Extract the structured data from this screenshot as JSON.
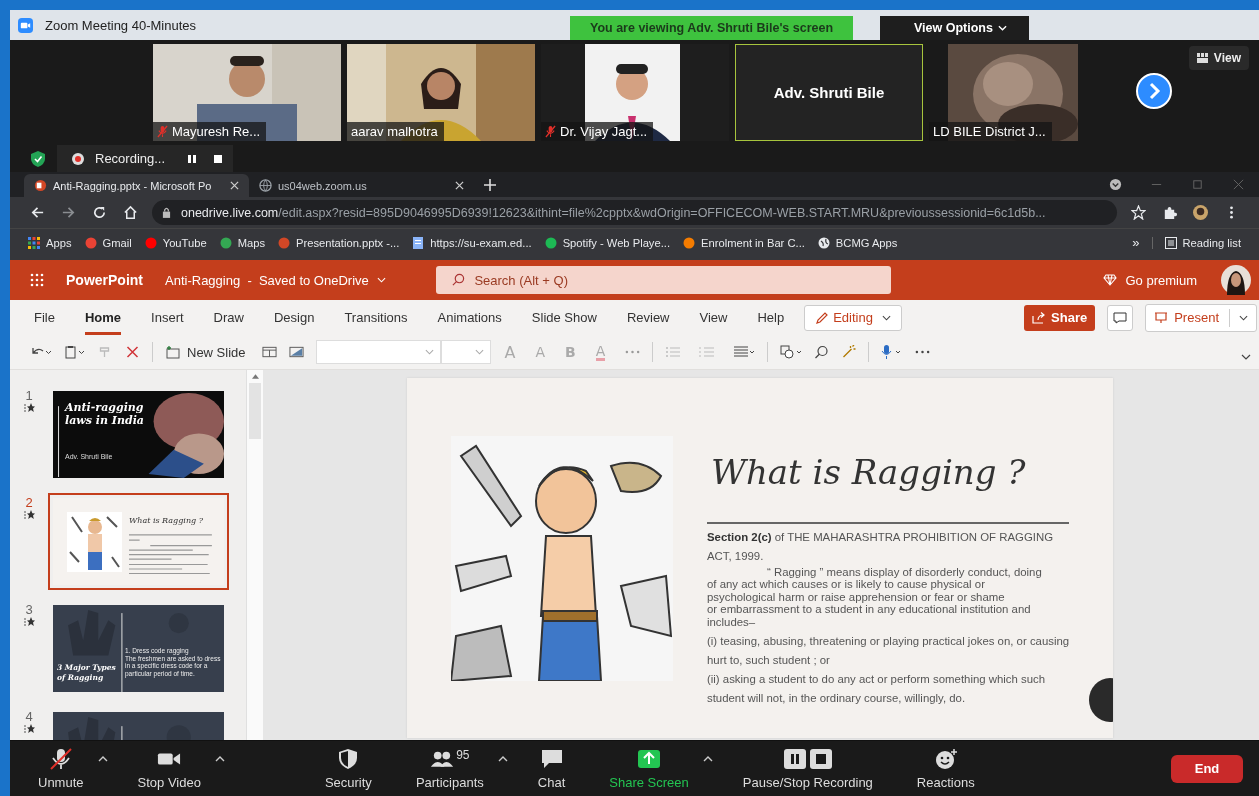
{
  "zoom_window": {
    "title": "Zoom Meeting 40-Minutes",
    "share_banner": "You are viewing Adv. Shruti Bile's screen",
    "view_options": "View Options",
    "view_button": "View"
  },
  "video_tiles": [
    {
      "name": "Mayuresh Re...",
      "muted": true,
      "kind": "video",
      "active_speaker": false
    },
    {
      "name": "aarav malhotra",
      "muted": false,
      "kind": "video",
      "active_speaker": false
    },
    {
      "name": "Dr. Vijay Jagt...",
      "muted": true,
      "kind": "video",
      "active_speaker": false
    },
    {
      "name": "Adv. Shruti Bile",
      "muted": false,
      "kind": "name",
      "active_speaker": true
    },
    {
      "name": "LD BILE District J...",
      "muted": false,
      "kind": "video",
      "active_speaker": false
    }
  ],
  "recording": {
    "label": "Recording..."
  },
  "browser": {
    "tabs": [
      {
        "title": "Anti-Ragging.pptx - Microsoft Po",
        "selected": true
      },
      {
        "title": "us04web.zoom.us",
        "selected": false
      }
    ],
    "url_host": "onedrive.live.com",
    "url_rest": "/edit.aspx?resid=895D9046995D6939!12623&ithint=file%2cpptx&wdOrigin=OFFICECOM-WEB.START.MRU&previoussessionid=6c1d5b...",
    "bookmarks": [
      "Apps",
      "Gmail",
      "YouTube",
      "Maps",
      "Presentation.pptx -...",
      "https://su-exam.ed...",
      "Spotify - Web Playe...",
      "Enrolment in Bar C...",
      "BCMG Apps"
    ],
    "bookmarks_more": "»",
    "reading_list": "Reading list"
  },
  "powerpoint": {
    "app": "PowerPoint",
    "doc_title": "Anti-Ragging  -  Saved to OneDrive",
    "search_placeholder": "Search (Alt + Q)",
    "premium": "Go premium",
    "tabs": [
      {
        "label": "File",
        "selected": false
      },
      {
        "label": "Home",
        "selected": true
      },
      {
        "label": "Insert",
        "selected": false
      },
      {
        "label": "Draw",
        "selected": false
      },
      {
        "label": "Design",
        "selected": false
      },
      {
        "label": "Transitions",
        "selected": false
      },
      {
        "label": "Animations",
        "selected": false
      },
      {
        "label": "Slide Show",
        "selected": false
      },
      {
        "label": "Review",
        "selected": false
      },
      {
        "label": "View",
        "selected": false
      },
      {
        "label": "Help",
        "selected": false
      }
    ],
    "editing": "Editing",
    "share": "Share",
    "present": "Present",
    "new_slide": "New Slide",
    "glyphs": [
      "A",
      "A",
      "B",
      "A"
    ]
  },
  "slides": [
    {
      "number": "1",
      "selected": false,
      "kind": "title",
      "title": "Anti-ragging laws in India",
      "subtitle": "Adv. Shruti Bile"
    },
    {
      "number": "2",
      "selected": true,
      "kind": "content",
      "title": "What is Ragging ?"
    },
    {
      "number": "3",
      "selected": false,
      "kind": "types",
      "title": "3 Major Types of Ragging",
      "heading": "1. Dress code ragging",
      "body": "The freshmen are asked to dress in a specific dress code for a particular period of time."
    },
    {
      "number": "4",
      "selected": false,
      "kind": "partial"
    }
  ],
  "slide": {
    "title": "What is Ragging ?",
    "paragraphs": [
      "**Section 2(c)** of THE MAHARASHTRA PROHIBITION OF RAGGING ACT, 1999.",
      "“ Ragging ” means display of disorderly conduct, doing\nof any act which causes or is likely to cause physical or\npsychological harm or raise apprehension or fear or shame\nor embarrassment to a student in any educational institution and\nincludes–",
      "(i) teasing, abusing, threatening or playing practical jokes on, or causing hurt to, such student ; or",
      "(ii) asking a student to do any act or perform something which such student will not, in the ordinary course, willingly, do."
    ]
  },
  "meeting_controls": [
    {
      "label": "Unmute"
    },
    {
      "label": "Stop Video"
    },
    {
      "label": "Security"
    },
    {
      "label": "Participants",
      "count": "95"
    },
    {
      "label": "Chat"
    },
    {
      "label": "Share Screen"
    },
    {
      "label": "Pause/Stop Recording"
    },
    {
      "label": "Reactions"
    }
  ],
  "end": "End"
}
